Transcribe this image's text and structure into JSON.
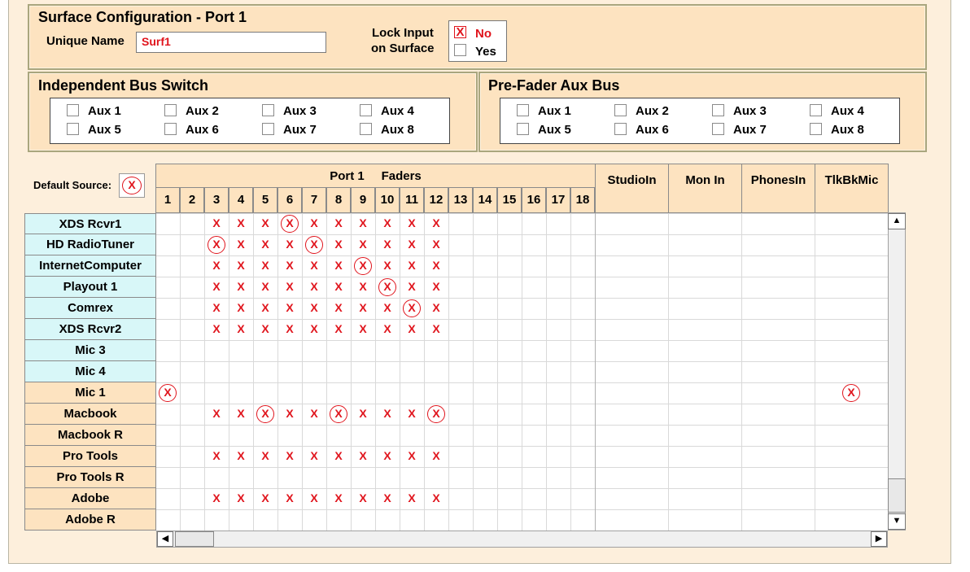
{
  "surface": {
    "title": "Surface Configuration - Port 1",
    "unique_name_label": "Unique Name",
    "unique_name_value": "Surf1",
    "lock_label_1": "Lock Input",
    "lock_label_2": "on Surface",
    "lock_options": [
      {
        "label": "No",
        "checked": true
      },
      {
        "label": "Yes",
        "checked": false
      }
    ]
  },
  "ibs": {
    "title": "Independent Bus Switch",
    "items": [
      "Aux 1",
      "Aux 2",
      "Aux 3",
      "Aux 4",
      "Aux 5",
      "Aux 6",
      "Aux 7",
      "Aux 8"
    ]
  },
  "pfa": {
    "title": "Pre-Fader Aux Bus",
    "items": [
      "Aux 1",
      "Aux 2",
      "Aux 3",
      "Aux 4",
      "Aux 5",
      "Aux 6",
      "Aux 7",
      "Aux 8"
    ]
  },
  "matrix": {
    "default_source_label": "Default Source:",
    "default_source_mark": "X",
    "group_title": "Port 1     Faders",
    "fader_numbers": [
      "1",
      "2",
      "3",
      "4",
      "5",
      "6",
      "7",
      "8",
      "9",
      "10",
      "11",
      "12",
      "13",
      "14",
      "15",
      "16",
      "17",
      "18"
    ],
    "extra_columns": [
      "StudioIn",
      "Mon In",
      "PhonesIn",
      "TlkBkMic"
    ],
    "mark": "X",
    "rows": [
      {
        "label": "XDS Rcvr1",
        "shade": "cyan",
        "x": [
          3,
          4,
          5,
          6,
          7,
          8,
          9,
          10,
          11,
          12
        ],
        "circled": [
          6
        ]
      },
      {
        "label": "HD RadioTuner",
        "shade": "cyan",
        "x": [
          3,
          4,
          5,
          6,
          7,
          8,
          9,
          10,
          11,
          12
        ],
        "circled": [
          3,
          7
        ]
      },
      {
        "label": "InternetComputer",
        "shade": "cyan",
        "x": [
          3,
          4,
          5,
          6,
          7,
          8,
          9,
          10,
          11,
          12
        ],
        "circled": [
          9
        ]
      },
      {
        "label": "Playout 1",
        "shade": "cyan",
        "x": [
          3,
          4,
          5,
          6,
          7,
          8,
          9,
          10,
          11,
          12
        ],
        "circled": [
          10
        ]
      },
      {
        "label": "Comrex",
        "shade": "cyan",
        "x": [
          3,
          4,
          5,
          6,
          7,
          8,
          9,
          10,
          11,
          12
        ],
        "circled": [
          11
        ]
      },
      {
        "label": "XDS Rcvr2",
        "shade": "cyan",
        "x": [
          3,
          4,
          5,
          6,
          7,
          8,
          9,
          10,
          11,
          12
        ],
        "circled": []
      },
      {
        "label": "Mic 3",
        "shade": "cyan",
        "x": [],
        "circled": []
      },
      {
        "label": "Mic 4",
        "shade": "cyan",
        "x": [],
        "circled": []
      },
      {
        "label": "Mic 1",
        "shade": "tan",
        "x": [],
        "circled": [
          1,
          "TlkBkMic"
        ]
      },
      {
        "label": "Macbook",
        "shade": "tan",
        "x": [
          3,
          4,
          5,
          6,
          7,
          8,
          9,
          10,
          11,
          12
        ],
        "circled": [
          5,
          8,
          12
        ]
      },
      {
        "label": "Macbook R",
        "shade": "tan",
        "x": [],
        "circled": []
      },
      {
        "label": "Pro Tools",
        "shade": "tan",
        "x": [
          3,
          4,
          5,
          6,
          7,
          8,
          9,
          10,
          11,
          12
        ],
        "circled": []
      },
      {
        "label": "Pro Tools R",
        "shade": "tan",
        "x": [],
        "circled": []
      },
      {
        "label": "Adobe",
        "shade": "tan",
        "x": [
          3,
          4,
          5,
          6,
          7,
          8,
          9,
          10,
          11,
          12
        ],
        "circled": []
      },
      {
        "label": "Adobe R",
        "shade": "tan",
        "x": [],
        "circled": []
      }
    ]
  },
  "colors": {
    "mark_red": "#e0141c",
    "row_cyan": "#d8f7f8",
    "row_tan": "#fde3c0",
    "panel_tan": "#fde3c0"
  },
  "icons": {
    "up": "▲",
    "down": "▼",
    "left": "◀",
    "right": "▶"
  }
}
